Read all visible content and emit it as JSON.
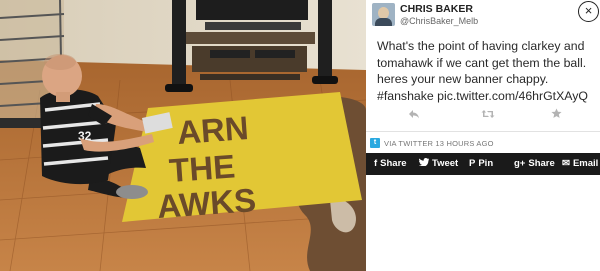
{
  "photo": {
    "banner_lines": [
      "ARN",
      "THE",
      "AWKS"
    ],
    "jersey_number": "32"
  },
  "tweet": {
    "author_name": "CHRIS BAKER",
    "author_handle": "@ChrisBaker_Melb",
    "close_symbol": "×",
    "text_before_link": "What's the point of having clarkey and tomahawk if we cant get them the ball. heres your new banner chappy. ",
    "hashtag": "#fanshake",
    "link_text": "pic.twitter.com/46hrGtXAyQ",
    "actions": {
      "reply_icon": "reply-icon",
      "retweet_icon": "retweet-icon",
      "favorite_icon": "star-icon"
    },
    "via_text": "VIA TWITTER 13 HOURS AGO"
  },
  "share": {
    "facebook": {
      "icon": "f",
      "label": "Share"
    },
    "twitter": {
      "icon": "t",
      "label": "Tweet"
    },
    "pinterest": {
      "icon": "P",
      "label": "Pin"
    },
    "googleplus": {
      "icon": "g+",
      "label": "Share"
    },
    "email": {
      "icon": "✉",
      "label": "Email"
    }
  },
  "colors": {
    "banner_yellow": "#e2c735",
    "banner_brown": "#6a4a2a",
    "floor_wood": "#b5703d",
    "share_bar": "#1a1a1a",
    "twitter_blue": "#2aa9e0"
  }
}
